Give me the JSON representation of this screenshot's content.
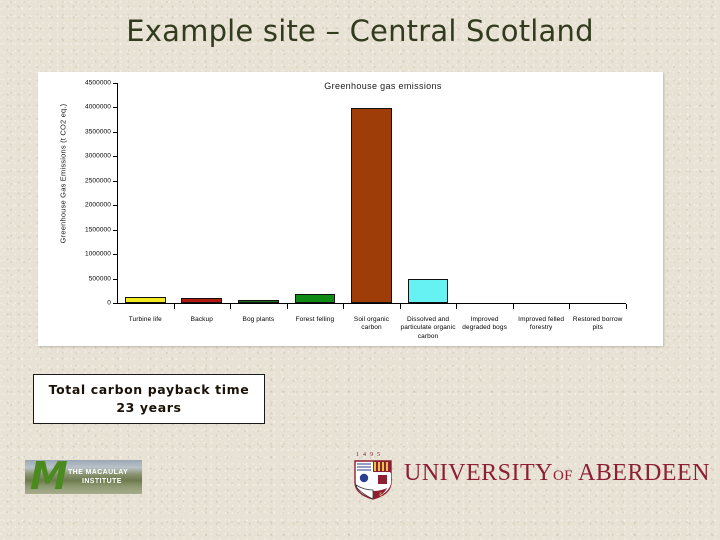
{
  "slide": {
    "title": "Example site – Central Scotland",
    "title_color": "#333b1f",
    "background_color": "#e8e2d4"
  },
  "payback": {
    "line1": "Total carbon payback time",
    "line2": "23 years"
  },
  "logos": {
    "macaulay": {
      "monogram": "M",
      "line1": "THE MACAULAY",
      "line2": "INSTITUTE"
    },
    "aberdeen": {
      "year": "1495",
      "name_main": "UNIVERSITY",
      "name_of": "OF",
      "name_place": "ABERDEEN",
      "color": "#8c1f33"
    }
  },
  "chart_data": {
    "type": "bar",
    "title": "Greenhouse gas emissions",
    "xlabel": "",
    "ylabel": "Greenhouse Gas Emissions (t CO2 eq.)",
    "ylim": [
      0,
      4500000
    ],
    "ytick_values": [
      0,
      500000,
      1000000,
      1500000,
      2000000,
      2500000,
      3000000,
      3500000,
      4000000,
      4500000
    ],
    "ytick_labels": [
      "0",
      "500000",
      "1000000",
      "1500000",
      "2000000",
      "2500000",
      "3000000",
      "3500000",
      "4000000",
      "4500000"
    ],
    "grid": false,
    "legend": "none",
    "categories": [
      "Turbine life",
      "Backup",
      "Bog plants",
      "Forest felling",
      "Soil organic carbon",
      "Dissolved and particulate organic carbon",
      "Improved degraded bogs",
      "Improved felled forestry",
      "Restored borrow pits"
    ],
    "values": [
      130000,
      110000,
      70000,
      190000,
      3980000,
      500000,
      0,
      0,
      0
    ],
    "colors": [
      "#f2eb1f",
      "#b01a10",
      "#1d6b1d",
      "#0f8a14",
      "#9e3d07",
      "#66f2f2",
      "#ffffff",
      "#ffffff",
      "#ffffff"
    ]
  }
}
